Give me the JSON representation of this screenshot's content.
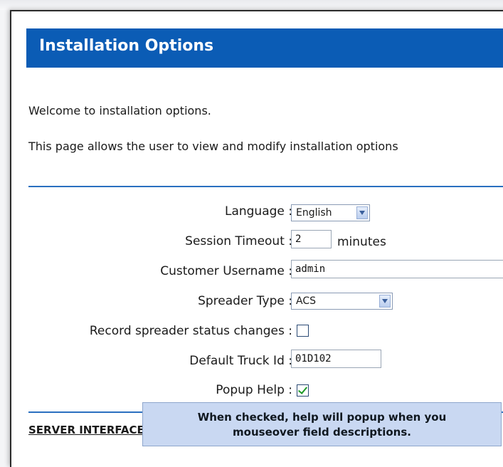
{
  "header": {
    "title": "Installation Options"
  },
  "intro": {
    "welcome": "Welcome to installation options.",
    "description": "This page allows the user to view and modify installation options"
  },
  "form": {
    "language": {
      "label": "Language :",
      "value": "English"
    },
    "session_timeout": {
      "label": "Session Timeout :",
      "value": "2",
      "suffix": "minutes"
    },
    "customer_username": {
      "label": "Customer Username :",
      "value": "admin"
    },
    "spreader_type": {
      "label": "Spreader Type :",
      "value": "ACS"
    },
    "record_status_changes": {
      "label": "Record spreader status changes :",
      "checked": false
    },
    "default_truck_id": {
      "label": "Default Truck Id :",
      "value": "01D102"
    },
    "popup_help": {
      "label": "Popup Help :",
      "checked": true
    }
  },
  "server_section": {
    "title": "SERVER INTERFACE",
    "clipped_text": ""
  },
  "tooltip": {
    "line1": "When checked, help will popup when you",
    "line2": "mouseover field descriptions."
  },
  "colors": {
    "header_bg": "#0b5cb5",
    "tooltip_bg": "#c9d8f2",
    "divider": "#2a6fc0",
    "check": "#1d9a27"
  }
}
